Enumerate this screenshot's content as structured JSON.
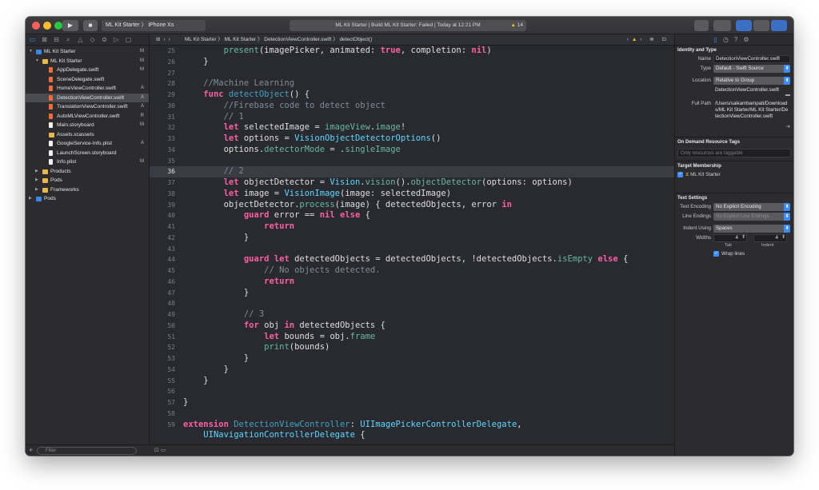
{
  "toolbar": {
    "scheme": "ML Kit Starter",
    "destination": "iPhone Xs",
    "status": "ML Kit Starter | Build ML Kit Starter: Failed | Today at 12:21 PM",
    "warning_count": "14"
  },
  "navigator": {
    "items": [
      {
        "label": "ML Kit Starter",
        "kind": "proj",
        "indent": 0,
        "disc": "▼",
        "status": "M"
      },
      {
        "label": "ML Kit Starter",
        "kind": "folder",
        "indent": 1,
        "disc": "▼",
        "status": "M"
      },
      {
        "label": "AppDelegate.swift",
        "kind": "swift",
        "indent": 2,
        "status": "M"
      },
      {
        "label": "SceneDelegate.swift",
        "kind": "swift",
        "indent": 2,
        "status": ""
      },
      {
        "label": "HomeViewController.swift",
        "kind": "swift",
        "indent": 2,
        "status": "A"
      },
      {
        "label": "DetectionViewController.swift",
        "kind": "swift",
        "indent": 2,
        "status": "A",
        "selected": true
      },
      {
        "label": "TranslationViewController.swift",
        "kind": "swift",
        "indent": 2,
        "status": "A"
      },
      {
        "label": "AutoMLViewController.swift",
        "kind": "swift",
        "indent": 2,
        "status": "R"
      },
      {
        "label": "Main.storyboard",
        "kind": "file",
        "indent": 2,
        "status": "M"
      },
      {
        "label": "Assets.xcassets",
        "kind": "folder",
        "indent": 2,
        "status": ""
      },
      {
        "label": "GoogleService-Info.plist",
        "kind": "file",
        "indent": 2,
        "status": "A"
      },
      {
        "label": "LaunchScreen.storyboard",
        "kind": "file",
        "indent": 2,
        "status": ""
      },
      {
        "label": "Info.plist",
        "kind": "file",
        "indent": 2,
        "status": "M"
      },
      {
        "label": "Products",
        "kind": "folder",
        "indent": 1,
        "disc": "▶",
        "status": ""
      },
      {
        "label": "Pods",
        "kind": "folder",
        "indent": 1,
        "disc": "▶",
        "status": ""
      },
      {
        "label": "Frameworks",
        "kind": "folder",
        "indent": 1,
        "disc": "▶",
        "status": ""
      },
      {
        "label": "Pods",
        "kind": "proj",
        "indent": 0,
        "disc": "▶",
        "status": ""
      }
    ],
    "filter_placeholder": "Filter"
  },
  "jumpbar": {
    "crumbs": [
      "ML Kit Starter",
      "ML Kit Starter",
      "DetectionViewController.swift",
      "detectObject()"
    ]
  },
  "code": {
    "current_line": 36,
    "lines": [
      {
        "n": 25,
        "s": [
          [
            "        ",
            ""
          ],
          [
            "present",
            "fn"
          ],
          [
            "(",
            ""
          ],
          [
            "imagePicker",
            ""
          ],
          [
            ", animated: ",
            ""
          ],
          [
            "true",
            "kw"
          ],
          [
            ", completion: ",
            ""
          ],
          [
            "nil",
            "kw"
          ],
          [
            ")",
            ""
          ]
        ]
      },
      {
        "n": 26,
        "s": [
          [
            "    }",
            ""
          ]
        ]
      },
      {
        "n": 27,
        "s": []
      },
      {
        "n": 28,
        "s": [
          [
            "    //Machine Learning",
            "cm"
          ]
        ]
      },
      {
        "n": 29,
        "s": [
          [
            "    ",
            ""
          ],
          [
            "func",
            "kw"
          ],
          [
            " ",
            ""
          ],
          [
            "detectObject",
            "decl"
          ],
          [
            "() {",
            ""
          ]
        ]
      },
      {
        "n": 30,
        "s": [
          [
            "        //Firebase code to detect object",
            "cm"
          ]
        ]
      },
      {
        "n": 31,
        "s": [
          [
            "        // 1",
            "cm"
          ]
        ]
      },
      {
        "n": 32,
        "s": [
          [
            "        ",
            ""
          ],
          [
            "let",
            "kw"
          ],
          [
            " selectedImage = ",
            ""
          ],
          [
            "imageView",
            "prop"
          ],
          [
            ".",
            ""
          ],
          [
            "image",
            "prop"
          ],
          [
            "!",
            ""
          ]
        ]
      },
      {
        "n": 33,
        "s": [
          [
            "        ",
            ""
          ],
          [
            "let",
            "kw"
          ],
          [
            " options = ",
            ""
          ],
          [
            "VisionObjectDetectorOptions",
            "type"
          ],
          [
            "()",
            ""
          ]
        ]
      },
      {
        "n": 34,
        "s": [
          [
            "        options.",
            ""
          ],
          [
            "detectorMode",
            "prop"
          ],
          [
            " = .",
            ""
          ],
          [
            "singleImage",
            "prop"
          ]
        ]
      },
      {
        "n": 35,
        "s": []
      },
      {
        "n": 36,
        "s": [
          [
            "        // 2",
            "cm"
          ]
        ]
      },
      {
        "n": 37,
        "s": [
          [
            "        ",
            ""
          ],
          [
            "let",
            "kw"
          ],
          [
            " objectDetector = ",
            ""
          ],
          [
            "Vision",
            "type"
          ],
          [
            ".",
            ""
          ],
          [
            "vision",
            "fn"
          ],
          [
            "().",
            ""
          ],
          [
            "objectDetector",
            "fn"
          ],
          [
            "(options: options)",
            ""
          ]
        ]
      },
      {
        "n": 38,
        "s": [
          [
            "        ",
            ""
          ],
          [
            "let",
            "kw"
          ],
          [
            " image = ",
            ""
          ],
          [
            "VisionImage",
            "type"
          ],
          [
            "(image: selectedImage)",
            ""
          ]
        ]
      },
      {
        "n": 39,
        "s": [
          [
            "        objectDetector.",
            ""
          ],
          [
            "process",
            "fn"
          ],
          [
            "(image) { detectedObjects, error ",
            ""
          ],
          [
            "in",
            "kw"
          ]
        ]
      },
      {
        "n": 40,
        "s": [
          [
            "            ",
            ""
          ],
          [
            "guard",
            "kw"
          ],
          [
            " error == ",
            ""
          ],
          [
            "nil",
            "kw"
          ],
          [
            " ",
            ""
          ],
          [
            "else",
            "kw"
          ],
          [
            " {",
            ""
          ]
        ]
      },
      {
        "n": 41,
        "s": [
          [
            "                ",
            ""
          ],
          [
            "return",
            "kw"
          ]
        ]
      },
      {
        "n": 42,
        "s": [
          [
            "            }",
            ""
          ]
        ]
      },
      {
        "n": 43,
        "s": []
      },
      {
        "n": 44,
        "s": [
          [
            "            ",
            ""
          ],
          [
            "guard",
            "kw"
          ],
          [
            " ",
            ""
          ],
          [
            "let",
            "kw"
          ],
          [
            " detectedObjects = detectedObjects, !detectedObjects.",
            ""
          ],
          [
            "isEmpty",
            "prop"
          ],
          [
            " ",
            ""
          ],
          [
            "else",
            "kw"
          ],
          [
            " {",
            ""
          ]
        ]
      },
      {
        "n": 45,
        "s": [
          [
            "                // No objects detected.",
            "cm"
          ]
        ]
      },
      {
        "n": 46,
        "s": [
          [
            "                ",
            ""
          ],
          [
            "return",
            "kw"
          ]
        ]
      },
      {
        "n": 47,
        "s": [
          [
            "            }",
            ""
          ]
        ]
      },
      {
        "n": 48,
        "s": []
      },
      {
        "n": 49,
        "s": [
          [
            "            // 3",
            "cm"
          ]
        ]
      },
      {
        "n": 50,
        "s": [
          [
            "            ",
            ""
          ],
          [
            "for",
            "kw"
          ],
          [
            " obj ",
            ""
          ],
          [
            "in",
            "kw"
          ],
          [
            " detectedObjects {",
            ""
          ]
        ]
      },
      {
        "n": 51,
        "s": [
          [
            "                ",
            ""
          ],
          [
            "let",
            "kw"
          ],
          [
            " bounds = obj.",
            ""
          ],
          [
            "frame",
            "prop"
          ]
        ]
      },
      {
        "n": 52,
        "s": [
          [
            "                ",
            ""
          ],
          [
            "print",
            "fn"
          ],
          [
            "(bounds)",
            ""
          ]
        ]
      },
      {
        "n": 53,
        "s": [
          [
            "            }",
            ""
          ]
        ]
      },
      {
        "n": 54,
        "s": [
          [
            "        }",
            ""
          ]
        ]
      },
      {
        "n": 55,
        "s": [
          [
            "    }",
            ""
          ]
        ]
      },
      {
        "n": 56,
        "s": []
      },
      {
        "n": 57,
        "s": [
          [
            "}",
            ""
          ]
        ]
      },
      {
        "n": 58,
        "s": []
      },
      {
        "n": 59,
        "s": [
          [
            "extension",
            "kw"
          ],
          [
            " ",
            ""
          ],
          [
            "DetectionViewController",
            "decl"
          ],
          [
            ": ",
            ""
          ],
          [
            "UIImagePickerControllerDelegate",
            "type"
          ],
          [
            ",",
            ""
          ]
        ]
      },
      {
        "n": "",
        "s": [
          [
            "    ",
            ""
          ],
          [
            "UINavigationControllerDelegate",
            "type"
          ],
          [
            " {",
            ""
          ]
        ]
      }
    ]
  },
  "inspector": {
    "identity_title": "Identity and Type",
    "name_label": "Name",
    "name_value": "DetectionViewController.swift",
    "type_label": "Type",
    "type_value": "Default - Swift Source",
    "location_label": "Location",
    "location_value": "Relative to Group",
    "location_file": "DetectionViewController.swift",
    "fullpath_label": "Full Path",
    "fullpath_value": "/Users/saikambampati/Downloads/ML Kit Starter/ML Kit Starter/DetectionViewController.swift",
    "odr_title": "On Demand Resource Tags",
    "odr_placeholder": "Only resources are taggable",
    "membership_title": "Target Membership",
    "membership_target": "ML Kit Starter",
    "text_title": "Text Settings",
    "encoding_label": "Text Encoding",
    "encoding_value": "No Explicit Encoding",
    "endings_label": "Line Endings",
    "endings_value": "No Explicit Line Endings",
    "indent_label": "Indent Using",
    "indent_value": "Spaces",
    "widths_label": "Widths",
    "tab_width": "4",
    "indent_width": "4",
    "tab_label": "Tab",
    "indent_sub_label": "Indent",
    "wrap_label": "Wrap lines"
  },
  "colors": {
    "keyword": "#fc5fa3",
    "comment": "#7f8c98",
    "type": "#5dd8ff",
    "function": "#67b7a4",
    "property": "#67b7a4",
    "declaration": "#41a1c0",
    "accent": "#3c8cff"
  }
}
